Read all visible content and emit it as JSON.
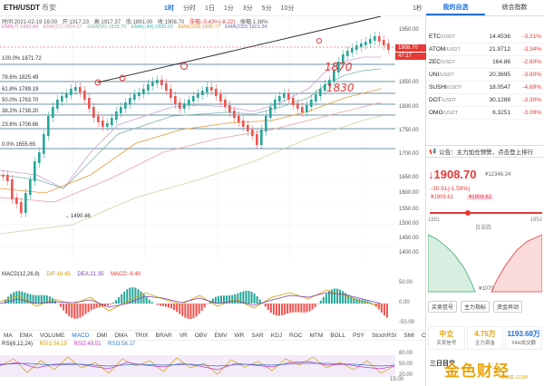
{
  "header": {
    "pair": "ETH/USDT",
    "exchange": "币安",
    "timeframes": [
      "1时",
      "分时",
      "1日",
      "1分",
      "3分",
      "5分",
      "10分"
    ],
    "active_timeframe": "1时",
    "right_label": "1秒"
  },
  "ohlc": {
    "time": "时间:2021-02-19 16:00",
    "open": "开:1917.23",
    "high": "高:1917.37",
    "low": "低:1891.00",
    "close": "收:1908.70",
    "change": "涨幅:-0.43%(-8.22)",
    "amplitude": "振幅:1.38%"
  },
  "ema_labels": [
    "EMA(7):1892.84",
    "EMA(21):1854.37",
    "EMA(55):1835.70",
    "EMA(144):1835.92",
    "EMA(120):1835.77",
    "EMA(233):1921.34"
  ],
  "price_axis": [
    "1950.00",
    "1900.00",
    "1850.00",
    "1800.00",
    "1750.00",
    "1700.00",
    "1650.00",
    "1600.00",
    "1550.00",
    "1500.00",
    "1450.00",
    "1400.00"
  ],
  "last_price": "1908.70",
  "countdown": "47:17",
  "fib_levels": [
    {
      "label": "100.0% 1871.72"
    },
    {
      "label": "78.6% 1825.49"
    },
    {
      "label": "61.8% 1789.19"
    },
    {
      "label": "50.0% 1763.70"
    },
    {
      "label": "38.2% 1738.20"
    },
    {
      "label": "23.6% 1706.66"
    },
    {
      "label": "0.0% 1655.65"
    }
  ],
  "low_marker": "1490.46",
  "handwritten": [
    "1870",
    "1830"
  ],
  "macd": {
    "title": "MACD(12,26,9)",
    "dif": "DIF:16.45",
    "dea": "DEA:21.35",
    "macd": "MACD:-9.40",
    "axis": [
      "50.00",
      "0.00",
      "-50.00"
    ]
  },
  "indicator_tabs": [
    "MA",
    "EMA",
    "VOLUME",
    "MACD",
    "DMI",
    "DMA",
    "TRIX",
    "BRAR",
    "VR",
    "OBV",
    "EMV",
    "WR",
    "SAR",
    "KDJ",
    "ROC",
    "MTM",
    "BOLL",
    "PSY",
    "StochRSI",
    "SMI",
    "CCI",
    "MFI"
  ],
  "active_indicator": "MACD",
  "rsi": {
    "title": "RSI(6,12,24)",
    "rsi1": "RSI1:34.19",
    "rsi2": "RSI2:49.51",
    "rsi3": "RSI3:56.17",
    "axis": [
      "80.00",
      "50.00",
      "20.00"
    ]
  },
  "panel": {
    "tabs": [
      "我的自选",
      "综合指数"
    ],
    "watchlist": [
      {
        "sym": "ETC",
        "quote": "/USDT",
        "price": "14.4536",
        "change": "-3.21%"
      },
      {
        "sym": "ATOM",
        "quote": "/USDT",
        "price": "21.9712",
        "change": "-3.34%"
      },
      {
        "sym": "ZEC",
        "quote": "/USDT",
        "price": "164.86",
        "change": "-2.60%"
      },
      {
        "sym": "UNI",
        "quote": "/USDT",
        "price": "20.3695",
        "change": "-3.60%"
      },
      {
        "sym": "SUSHI",
        "quote": "/USDT",
        "price": "18.0547",
        "change": "-4.69%"
      },
      {
        "sym": "DOT",
        "quote": "/USDT",
        "price": "30.1288",
        "change": "-3.30%"
      },
      {
        "sym": "OMG",
        "quote": "/USDT",
        "price": "6.3251",
        "change": "-3.09%"
      }
    ],
    "notice": "公告：主力加仓预警，点击登上排行",
    "big_price": "1908.70",
    "sub_price": "¥12346.24",
    "change": "-30.91(-1.59%)",
    "bid": "¥1909.61",
    "ask": "¥1909.62",
    "depth_left": "1891",
    "depth_mid": "日涨跌",
    "depth_right": "1952",
    "depth_bottom": "¥1070",
    "sub_tabs": [
      "买卖信号",
      "主力指标",
      "资金异动"
    ],
    "summary": [
      {
        "value": "中立",
        "label": "买卖信号"
      },
      {
        "value": "4.75万",
        "label": "主力资金"
      },
      {
        "value": "1193.68万",
        "label": "24H成交额"
      }
    ],
    "sanri": "三日目交",
    "watermark": "金色财经",
    "watermark_sub": "JINSE.COM"
  },
  "bottom_time": "15:00"
}
